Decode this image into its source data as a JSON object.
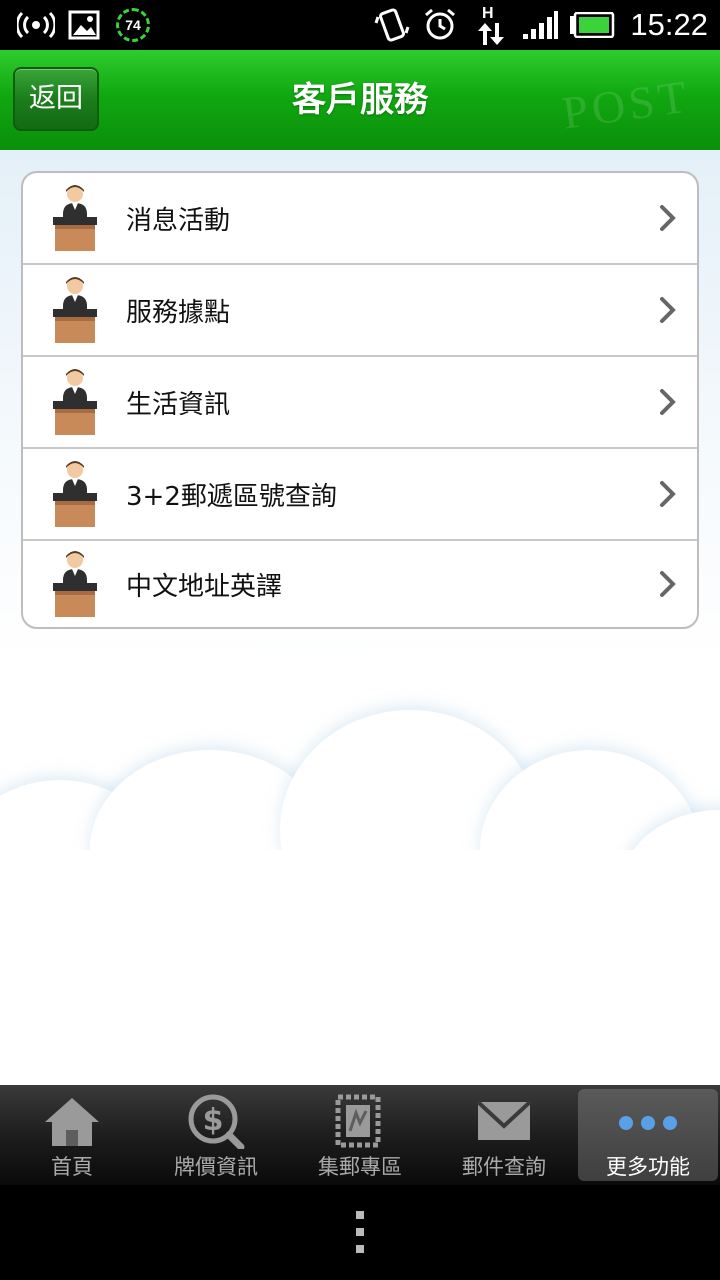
{
  "status_bar": {
    "time": "15:22",
    "badge_value": "74",
    "icons": [
      "wireless-icon",
      "image-icon",
      "download-progress-icon",
      "vibrate-icon",
      "alarm-icon",
      "hspa-data-icon",
      "signal-icon",
      "battery-icon"
    ]
  },
  "header": {
    "back_label": "返回",
    "title": "客戶服務"
  },
  "menu": {
    "items": [
      {
        "label": "消息活動"
      },
      {
        "label": "服務據點"
      },
      {
        "label": "生活資訊"
      },
      {
        "label": "3+2郵遞區號查詢"
      },
      {
        "label": "中文地址英譯"
      }
    ]
  },
  "tabs": [
    {
      "label": "首頁",
      "icon": "home-icon"
    },
    {
      "label": "牌價資訊",
      "icon": "dollar-search-icon"
    },
    {
      "label": "集郵專區",
      "icon": "stamp-icon"
    },
    {
      "label": "郵件查詢",
      "icon": "mail-icon"
    },
    {
      "label": "更多功能",
      "icon": "more-dots-icon",
      "active": true
    }
  ],
  "colors": {
    "header_green": "#11a811",
    "tab_bar": "#1e1e1e"
  }
}
